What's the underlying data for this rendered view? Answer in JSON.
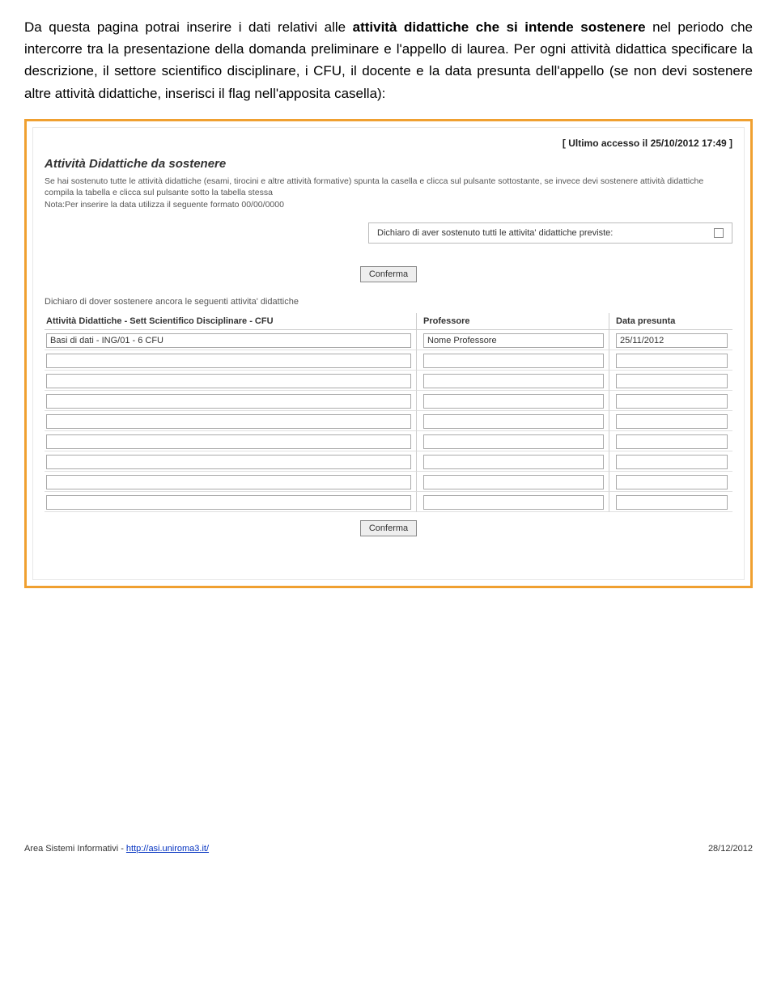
{
  "intro": {
    "p1_a": "Da questa pagina potrai inserire i dati relativi alle ",
    "p1_b": "attività didattiche che si intende sostenere",
    "p1_c": " nel periodo che intercorre tra la presentazione della domanda preliminare e l'appello di laurea.",
    "p2": "Per ogni attività didattica specificare la descrizione, il settore scientifico disciplinare, i CFU, il docente e la data presunta dell'appello (se non devi sostenere altre attività didattiche, inserisci il flag nell'apposita casella):"
  },
  "panel": {
    "last_access": "[ Ultimo accesso il 25/10/2012 17:49 ]",
    "section_title": "Attività Didattiche da sostenere",
    "instr_line1": "Se hai sostenuto tutte le attività didattiche (esami, tirocini e altre attività formative) spunta la casella e clicca sul pulsante sottostante, se invece devi sostenere attività didattiche compila la tabella e clicca sul pulsante sotto la tabella stessa",
    "instr_line2": "Nota:Per inserire la data utilizza il seguente formato 00/00/0000",
    "declare_done": "Dichiaro di aver sostenuto tutti le attivita' didattiche previste:",
    "confirm_btn": "Conferma",
    "declare_pending": "Dichiaro di dover sostenere ancora le seguenti attivita' didattiche",
    "headers": {
      "att": "Attività Didattiche - Sett Scientifico Disciplinare - CFU",
      "prof": "Professore",
      "date": "Data presunta"
    },
    "rows": [
      {
        "att": "Basi di dati - ING/01 - 6 CFU",
        "prof": "Nome Professore",
        "date": "25/11/2012"
      },
      {
        "att": "",
        "prof": "",
        "date": ""
      },
      {
        "att": "",
        "prof": "",
        "date": ""
      },
      {
        "att": "",
        "prof": "",
        "date": ""
      },
      {
        "att": "",
        "prof": "",
        "date": ""
      },
      {
        "att": "",
        "prof": "",
        "date": ""
      },
      {
        "att": "",
        "prof": "",
        "date": ""
      },
      {
        "att": "",
        "prof": "",
        "date": ""
      },
      {
        "att": "",
        "prof": "",
        "date": ""
      }
    ]
  },
  "footer": {
    "left_prefix": "Area Sistemi Informativi - ",
    "left_link": "http://asi.uniroma3.it/",
    "right": "28/12/2012"
  }
}
